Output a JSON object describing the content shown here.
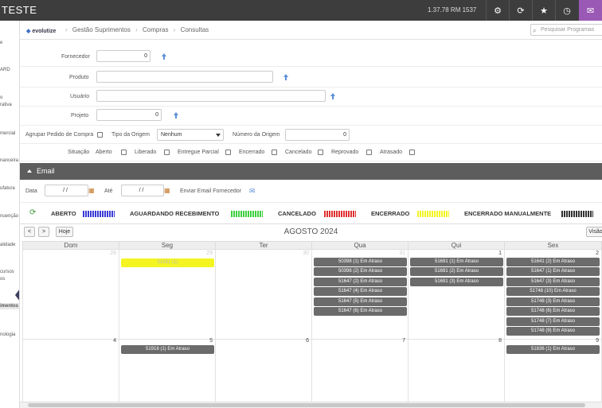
{
  "topbar": {
    "title": "TESTE",
    "version": "1.37.78 RM 1537",
    "icons": [
      "gear-icon",
      "refresh-icon",
      "star-icon",
      "clock-icon",
      "mail-icon"
    ]
  },
  "sidebar": {
    "items": [
      "e",
      "ARD",
      "o",
      "rativa",
      "mercial",
      "nanceira",
      "ufatura",
      "nuenção",
      "alidade",
      "cursos",
      "os",
      "imentos",
      "nologia"
    ]
  },
  "breadcrumb": {
    "logo_prefix": "evolu",
    "logo_suffix": "tize",
    "items": [
      "Gestão Suprimentos",
      "Compras",
      "Consultas"
    ]
  },
  "search": {
    "placeholder": "Pesquisar Programas"
  },
  "form": {
    "fornecedor_label": "Fornecedor",
    "fornecedor_value": "0",
    "produto_label": "Produto",
    "produto_value": "",
    "usuario_label": "Usuário",
    "usuario_value": "",
    "projeto_label": "Projeto",
    "projeto_value": "0",
    "agrupar_label": "Agrupar Pedido de Compra",
    "tipo_origem_label": "Tipo da Origem",
    "tipo_origem_value": "Nenhum",
    "numero_origem_label": "Número da Origem",
    "numero_origem_value": "0",
    "situacao_label": "Situação",
    "situacoes": [
      "Aberto",
      "Liberado",
      "Entregue Parcial",
      "Encerrado",
      "Cancelado",
      "Reprovado",
      "Atrasado"
    ]
  },
  "email": {
    "section_label": "Email",
    "data_label": "Data",
    "data_value": "/ /",
    "ate_label": "Até",
    "ate_value": "/ /",
    "enviar_label": "Enviar Email Fornecedor"
  },
  "legend": [
    {
      "label": "ABERTO",
      "color": "#3b3bd6"
    },
    {
      "label": "AGUARDANDO RECEBIMENTO",
      "color": "#3fcf3f"
    },
    {
      "label": "CANCELADO",
      "color": "#e03030"
    },
    {
      "label": "ENCERRADO",
      "color": "#f4f423"
    },
    {
      "label": "ENCERRADO MANUALMENTE",
      "color": "#333333"
    }
  ],
  "calendar": {
    "prev": "<",
    "next": ">",
    "today": "Hoje",
    "view": "Visão",
    "title": "AGOSTO 2024",
    "days": [
      "Dom",
      "Seg",
      "Ter",
      "Qua",
      "Qui",
      "Sex"
    ],
    "week1_nums": [
      "28",
      "29",
      "30",
      "31",
      "1",
      "2"
    ],
    "week2_nums": [
      "4",
      "5",
      "6",
      "7",
      "8",
      "9"
    ],
    "seg_w1": [
      "51631 (1)"
    ],
    "qua_w1": [
      "50398 (1) Em Atraso",
      "50398 (2) Em Atraso",
      "51647 (2) Em Atraso",
      "51647 (4) Em Atraso",
      "51647 (5) Em Atraso",
      "51647 (6) Em Atraso"
    ],
    "qui_w1": [
      "51691 (1) Em Atraso",
      "51691 (2) Em Atraso",
      "51691 (3) Em Atraso"
    ],
    "sex_w1": [
      "51641 (2) Em Atraso",
      "51647 (1) Em Atraso",
      "51647 (3) Em Atraso",
      "51748 (10) Em Atraso",
      "51748 (3) Em Atraso",
      "51748 (6) Em Atraso",
      "51748 (7) Em Atraso",
      "51748 (9) Em Atraso"
    ],
    "seg_w2": [
      "51918 (1) Em Atraso"
    ],
    "sex_w2": [
      "51836 (1) Em Atraso"
    ]
  }
}
